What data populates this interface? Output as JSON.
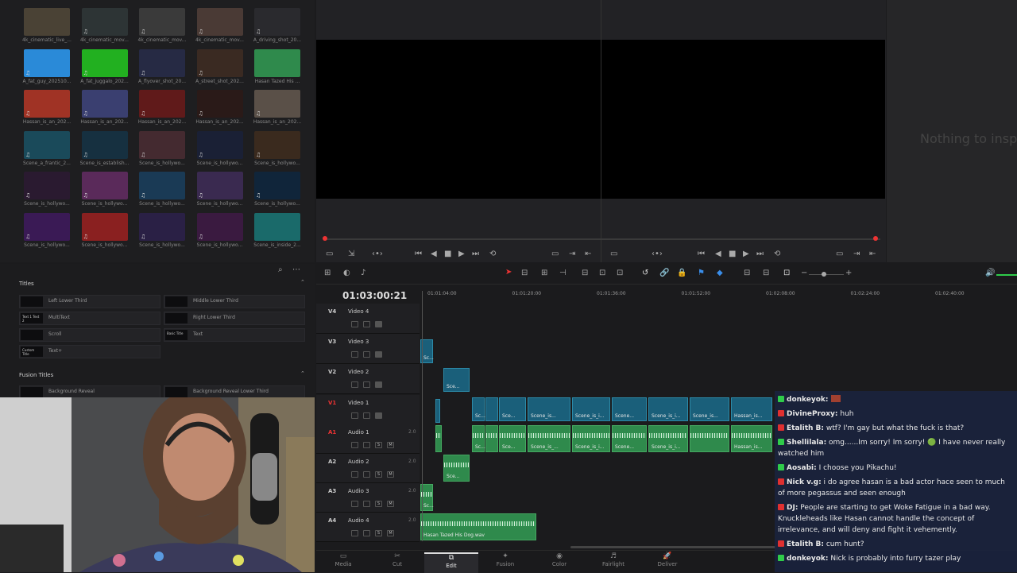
{
  "media_pool": {
    "thumbs": [
      {
        "label": "4k_cinematic_live_...",
        "color": "#4a4235",
        "audio": false
      },
      {
        "label": "4k_cinematic_mov...",
        "color": "#2d3435",
        "audio": true
      },
      {
        "label": "4k_cinematic_mov...",
        "color": "#3a3a3a",
        "audio": true
      },
      {
        "label": "4k_cinematic_mov...",
        "color": "#4a3a35",
        "audio": true
      },
      {
        "label": "A_driving_shot_20...",
        "color": "#2a2a2e",
        "audio": true
      },
      {
        "label": "A_fat_guy_202510...",
        "color": "#2a8ad8",
        "audio": true
      },
      {
        "label": "A_fat_juggalo_202...",
        "color": "#22b020",
        "audio": true
      },
      {
        "label": "A_flyover_shot_20...",
        "color": "#262a44",
        "audio": true
      },
      {
        "label": "A_street_shot_202...",
        "color": "#3a2a22",
        "audio": true
      },
      {
        "label": "Hasan Tazed His ...",
        "color": "#2f8a4c",
        "audio": false
      },
      {
        "label": "Hassan_is_an_202...",
        "color": "#a03325",
        "audio": true
      },
      {
        "label": "Hassan_is_an_202...",
        "color": "#3a3f70",
        "audio": true
      },
      {
        "label": "Hassan_is_an_202...",
        "color": "#601a1a",
        "audio": true
      },
      {
        "label": "Hassan_is_an_202...",
        "color": "#2a1a18",
        "audio": true
      },
      {
        "label": "Hassan_is_an_202...",
        "color": "#5a5048",
        "audio": true
      },
      {
        "label": "Scene_a_frantic_2...",
        "color": "#1a4a5a",
        "audio": true
      },
      {
        "label": "Scene_is_establish...",
        "color": "#163040",
        "audio": true
      },
      {
        "label": "Scene_is_hollywo...",
        "color": "#442a30",
        "audio": true
      },
      {
        "label": "Scene_is_hollywo...",
        "color": "#1a2035",
        "audio": true
      },
      {
        "label": "Scene_is_hollywo...",
        "color": "#3a2a1e",
        "audio": true
      },
      {
        "label": "Scene_is_hollywo...",
        "color": "#2a1a30",
        "audio": true
      },
      {
        "label": "Scene_is_hollywo...",
        "color": "#5a2a5a",
        "audio": true
      },
      {
        "label": "Scene_is_hollywo...",
        "color": "#1a3a55",
        "audio": true
      },
      {
        "label": "Scene_is_hollywo...",
        "color": "#3a2a50",
        "audio": true
      },
      {
        "label": "Scene_is_hollywo...",
        "color": "#10253a",
        "audio": true
      },
      {
        "label": "Scene_is_hollywo...",
        "color": "#3a1a55",
        "audio": true
      },
      {
        "label": "Scene_is_hollywo...",
        "color": "#8a2020",
        "audio": true
      },
      {
        "label": "Scene_is_hollywo...",
        "color": "#2a2045",
        "audio": true
      },
      {
        "label": "Scene_is_hollywo...",
        "color": "#3a1a40",
        "audio": true
      },
      {
        "label": "Scene_is_inside_2...",
        "color": "#1a6a6a",
        "audio": false
      }
    ]
  },
  "inspector": {
    "empty_text": "Nothing to insp"
  },
  "effects": {
    "titles_header": "Titles",
    "fusion_header": "Fusion Titles",
    "titles": [
      {
        "icon": "",
        "label": "Left Lower Third"
      },
      {
        "icon": "",
        "label": "Middle Lower Third"
      },
      {
        "icon": "Text 1 Text 2",
        "label": "MultiText"
      },
      {
        "icon": "",
        "label": "Right Lower Third"
      },
      {
        "icon": "",
        "label": "Scroll"
      },
      {
        "icon": "Basic Title",
        "label": "Text"
      },
      {
        "icon": "Custom Title",
        "label": "Text+"
      }
    ],
    "fusion": [
      {
        "label": "Background Reveal"
      },
      {
        "label": "Background Reveal Lower Third"
      }
    ]
  },
  "timeline": {
    "timecode": "01:03:00:21",
    "ruler": [
      "01:01:04:00",
      "01:01:20:00",
      "01:01:36:00",
      "01:01:52:00",
      "01:02:08:00",
      "01:02:24:00",
      "01:02:40:00"
    ],
    "tracks": [
      {
        "badge": "V4",
        "name": "Video 4",
        "type": "video",
        "num": ""
      },
      {
        "badge": "V3",
        "name": "Video 3",
        "type": "video",
        "num": ""
      },
      {
        "badge": "V2",
        "name": "Video 2",
        "type": "video",
        "num": ""
      },
      {
        "badge": "V1",
        "name": "Video 1",
        "type": "video",
        "num": ""
      },
      {
        "badge": "A1",
        "name": "Audio 1",
        "type": "audio",
        "num": "2.0"
      },
      {
        "badge": "A2",
        "name": "Audio 2",
        "type": "audio",
        "num": "2.0"
      },
      {
        "badge": "A3",
        "name": "Audio 3",
        "type": "audio",
        "num": "2.0"
      },
      {
        "badge": "A4",
        "name": "Audio 4",
        "type": "audio",
        "num": "2.0"
      }
    ],
    "clip_labels": {
      "sc": "Sc...",
      "sce": "Sce...",
      "scene_is": "Scene_is...",
      "scene_is_i": "Scene_is_i...",
      "scene_dots": "Scene...",
      "hassan_is": "Hassan_is...",
      "scene_is_2": "Scene_is_...",
      "audio4": "Hasan Tazed His Dog.wav"
    },
    "solo_label": "S",
    "mute_label": "M"
  },
  "pages": [
    {
      "label": "Media",
      "icon": "▭"
    },
    {
      "label": "Cut",
      "icon": "✂"
    },
    {
      "label": "Edit",
      "icon": "⧉",
      "active": true
    },
    {
      "label": "Fusion",
      "icon": "✦"
    },
    {
      "label": "Color",
      "icon": "◉"
    },
    {
      "label": "Fairlight",
      "icon": "♬"
    },
    {
      "label": "Deliver",
      "icon": "🚀"
    }
  ],
  "chat": [
    {
      "user": "donkeyok:",
      "text": "",
      "badge_color": "#2fcc4a"
    },
    {
      "user": "DivineProxy:",
      "text": " huh",
      "badge_color": "#e03030"
    },
    {
      "user": "Etalith B:",
      "text": " wtf? I'm gay but what the fuck is that?",
      "badge_color": "#e03030"
    },
    {
      "user": "Shellilala:",
      "text": " omg......Im sorry! Im sorry! 🟢 I have never really watched him",
      "badge_color": "#2fcc4a"
    },
    {
      "user": "Aosabi:",
      "text": " I choose you Pikachu!",
      "badge_color": "#2fcc4a"
    },
    {
      "user": "Nick v.g:",
      "text": " i do agree hasan is a bad actor hace seen to much of more pegassus and seen enough",
      "badge_color": "#e03030"
    },
    {
      "user": "DJ:",
      "text": " People are starting to get Woke Fatigue in a bad way. Knuckleheads like Hasan cannot handle the concept of irrelevance, and will deny and fight it vehemently.",
      "badge_color": "#e03030"
    },
    {
      "user": "Etalith B:",
      "text": " cum hunt?",
      "badge_color": "#e03030"
    },
    {
      "user": "donkeyok:",
      "text": " Nick is probably into furry tazer play",
      "badge_color": "#2fcc4a"
    }
  ]
}
